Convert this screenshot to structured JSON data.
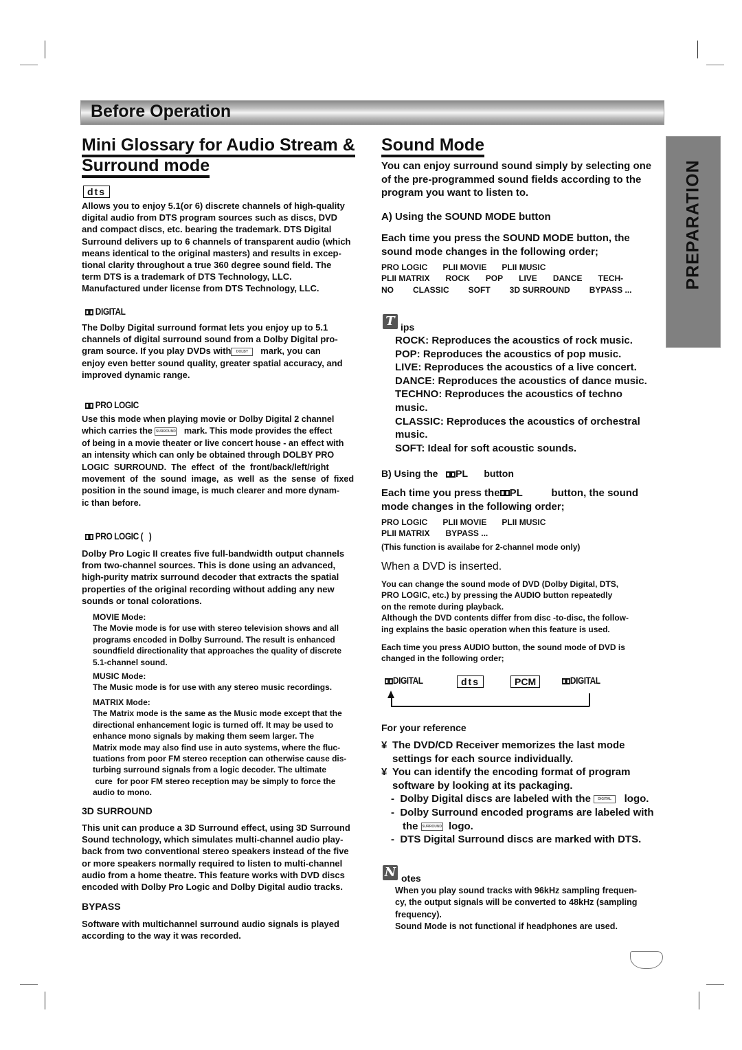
{
  "header": {
    "title": "Before Operation"
  },
  "side_tab": {
    "label": "PREPARATION"
  },
  "left": {
    "title_line1": "Mini Glossary for Audio Stream &",
    "title_line2": "Surround mode",
    "dts": {
      "logo": "dts",
      "lines": [
        "Allows you to enjoy 5.1(or 6) discrete channels of high-quality",
        "digital audio from DTS program sources such as discs, DVD",
        "and compact discs, etc. bearing the trademark. DTS Digital",
        "Surround delivers up to 6 channels of transparent audio (which",
        "means identical to the original masters) and results in excep-",
        "tional clarity throughout a true 360 degree sound field. The",
        "term DTS is a trademark of DTS Technology, LLC.",
        "Manufactured under license from DTS Technology, LLC."
      ]
    },
    "dolby_digital": {
      "logo": "DIGITAL",
      "lines": [
        "The Dolby Digital surround format lets you enjoy up to 5.1",
        "channels of digital surround sound from a Dolby Digital pro-",
        "gram source. If you play DVDs with",
        "mark, you can",
        "enjoy even better sound quality, greater spatial accuracy, and",
        "improved dynamic range."
      ]
    },
    "pro_logic": {
      "logo": "PRO LOGIC",
      "lines": [
        "Use this mode when playing movie or Dolby Digital 2 channel",
        "which carries the",
        "mark. This mode provides the effect",
        "of being in a movie theater or live concert house - an effect with",
        "an intensity which can only be obtained through DOLBY PRO",
        "LOGIC  SURROUND.  The  effect  of  the  front/back/left/right",
        "movement  of  the  sound  image,  as  well  as  the  sense  of  fixed",
        "position in the sound image, is much clearer and more dynam-",
        "ic than before."
      ]
    },
    "pro_logic_2": {
      "logo": "PRO LOGIC (   )",
      "lines": [
        "Dolby Pro Logic II creates five full-bandwidth output channels",
        "from two-channel sources. This is done using an advanced,",
        "high-purity matrix surround decoder that extracts the spatial",
        "properties of the original recording without adding any new",
        "sounds or tonal colorations."
      ],
      "modes": [
        {
          "title": "MOVIE Mode:",
          "lines": [
            "The Movie mode is for use with stereo television shows and all",
            "programs encoded in Dolby Surround. The result is enhanced",
            "soundfield directionality that approaches the quality of discrete",
            "5.1-channel sound."
          ]
        },
        {
          "title": "MUSIC Mode:",
          "lines": [
            "The Music mode is for use with any stereo music recordings."
          ]
        },
        {
          "title": "MATRIX Mode:",
          "lines": [
            "The Matrix mode is the same as the Music mode except that the",
            "directional enhancement logic is turned off. It may be used to",
            "enhance mono signals by making them seem larger. The",
            "Matrix mode may also find use in auto systems, where the fluc-",
            "tuations from poor FM stereo reception can otherwise cause dis-",
            "turbing surround signals from a logic decoder. The ultimate",
            " cure  for poor FM stereo reception may be simply to force the",
            "audio to mono."
          ]
        }
      ]
    },
    "surround_3d": {
      "title": "3D SURROUND",
      "lines": [
        "This unit can produce a 3D Surround effect, using 3D Surround",
        "Sound technology, which simulates multi-channel audio play-",
        "back from two conventional stereo speakers instead of the five",
        "or more speakers normally required to listen to multi-channel",
        "audio from a home theatre. This feature works with DVD discs",
        "encoded with Dolby Pro Logic and Dolby Digital audio tracks."
      ]
    },
    "bypass": {
      "title": "BYPASS",
      "lines": [
        "Software with multichannel surround audio signals is played",
        "according to the way it was recorded."
      ]
    }
  },
  "right": {
    "title": "Sound Mode",
    "intro": [
      "You can enjoy surround sound simply by selecting one",
      "of the pre-programmed sound fields according to the",
      "program you want to listen to."
    ],
    "section_a": {
      "title": "A) Using the SOUND MODE button",
      "lines": [
        "Each time you press the SOUND MODE button, the",
        "sound mode changes in the following order;"
      ],
      "sequence_rows": [
        [
          "PRO LOGIC",
          "PLII MOVIE",
          "PLII MUSIC"
        ],
        [
          "PLII MATRIX",
          "ROCK",
          "POP",
          "LIVE",
          "DANCE",
          "TECH-"
        ],
        [
          "NO",
          "CLASSIC",
          "SOFT",
          "3D SURROUND",
          "BYPASS ..."
        ]
      ]
    },
    "tips": {
      "icon_letter": "T",
      "label": "ips",
      "lines": [
        "ROCK: Reproduces the acoustics of rock music.",
        "POP: Reproduces the acoustics of pop music.",
        "LIVE: Reproduces the acoustics of a live concert.",
        "DANCE: Reproduces the acoustics of dance music.",
        "TECHNO: Reproduces the acoustics of techno",
        "music.",
        "CLASSIC: Reproduces the acoustics of orchestral",
        "music.",
        "SOFT: Ideal for soft acoustic sounds."
      ]
    },
    "section_b": {
      "title_pre": "B) Using the",
      "title_logo": "PL",
      "title_post": "button",
      "line1_pre": "Each time you press the",
      "line1_logo": "PL",
      "line1_post": "button, the sound",
      "line2": "mode changes in the following order;",
      "sequence_rows": [
        [
          "PRO LOGIC",
          "PLII MOVIE",
          "PLII MUSIC"
        ],
        [
          "PLII MATRIX",
          "BYPASS ..."
        ]
      ],
      "note": "(This function is availabe for 2-channel mode only)"
    },
    "dvd": {
      "title": "When a DVD is inserted.",
      "lines": [
        "You can change the sound mode of DVD (Dolby Digital, DTS,",
        "PRO LOGIC, etc.) by pressing the AUDIO button repeatedly",
        "on the remote during playback.",
        "Although the DVD contents differ from disc -to-disc, the follow-",
        "ing explains the basic operation when this feature is used."
      ],
      "lines2": [
        "Each time you press AUDIO button, the sound mode of DVD is",
        "changed in the following order;"
      ],
      "cycle": [
        "DIGITAL",
        "dts",
        "PCM",
        "DIGITAL"
      ]
    },
    "reference": {
      "title": "For your reference",
      "bullet_glyph": "¥",
      "bullets": [
        {
          "lines": [
            "The DVD/CD Receiver memorizes the last mode",
            "settings for each source individually."
          ]
        },
        {
          "lines": [
            "You can identify the encoding format of program",
            "software by looking at its packaging."
          ]
        }
      ],
      "dashes": [
        {
          "pre": "Dolby Digital discs are labeled with the",
          "post": "logo."
        },
        {
          "pre": "Dolby Surround encoded programs are labeled with",
          "line2_pre": "the",
          "post": "logo."
        },
        {
          "pre": "DTS Digital Surround discs are marked with DTS."
        }
      ]
    },
    "notes": {
      "icon_letter": "N",
      "label": "otes",
      "lines": [
        "When you play sound tracks with 96kHz sampling frequen-",
        "cy, the output signals will be converted to 48kHz (sampling",
        "frequency).",
        "Sound Mode is not functional if headphones are used."
      ]
    }
  },
  "mini_logo_text": {
    "dolby": "DOLBY",
    "digital": "DIGITAL",
    "surround": "SURROUND"
  }
}
